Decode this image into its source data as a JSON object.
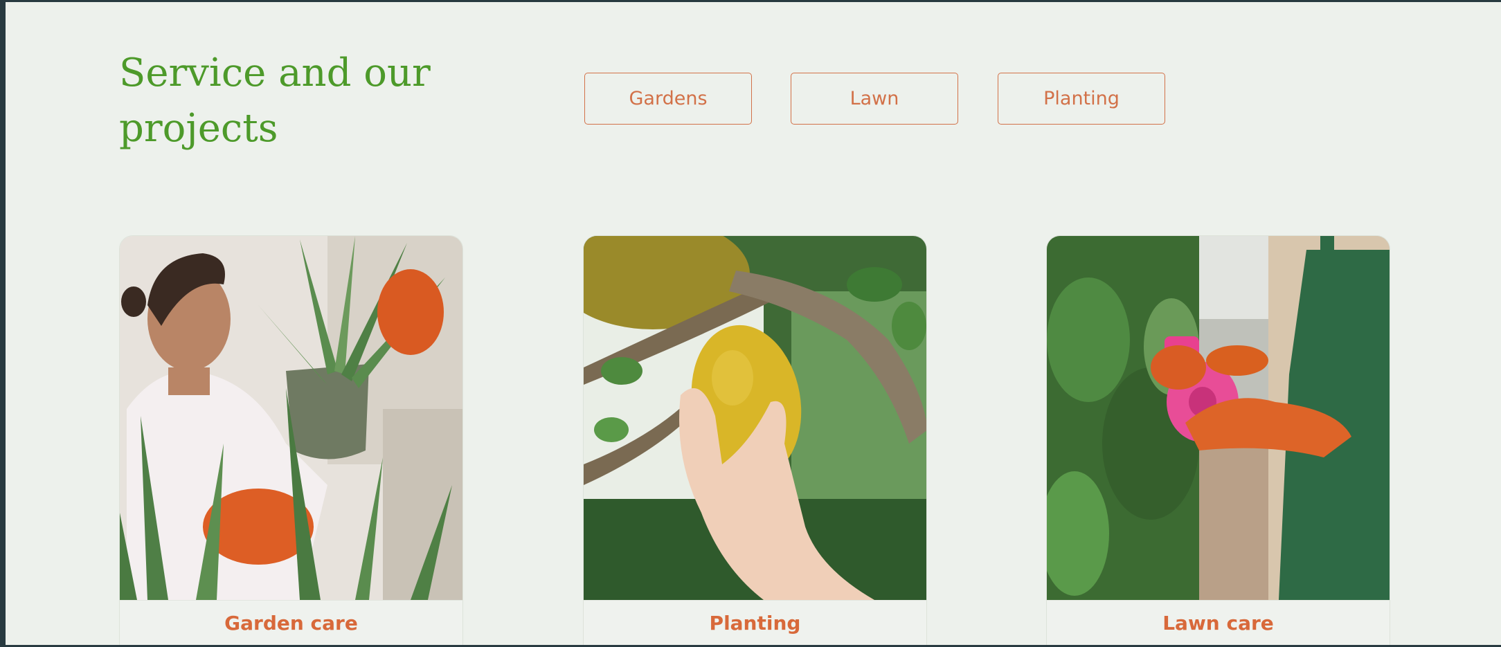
{
  "section": {
    "heading": "Service and our projects"
  },
  "filters": [
    {
      "label": "Gardens"
    },
    {
      "label": "Lawn"
    },
    {
      "label": "Planting"
    }
  ],
  "cards": [
    {
      "title": "Garden care",
      "image_subject": "woman in orange gloves holding potted aloe plant"
    },
    {
      "title": "Planting",
      "image_subject": "hand holding yellow lemon on branch"
    },
    {
      "title": "Lawn care",
      "image_subject": "gardener in green apron with pink spray bottle"
    }
  ],
  "colors": {
    "background": "#edf1ec",
    "heading_green": "#4d9a2a",
    "accent_orange": "#d27148",
    "frame_dark": "#283a40"
  }
}
